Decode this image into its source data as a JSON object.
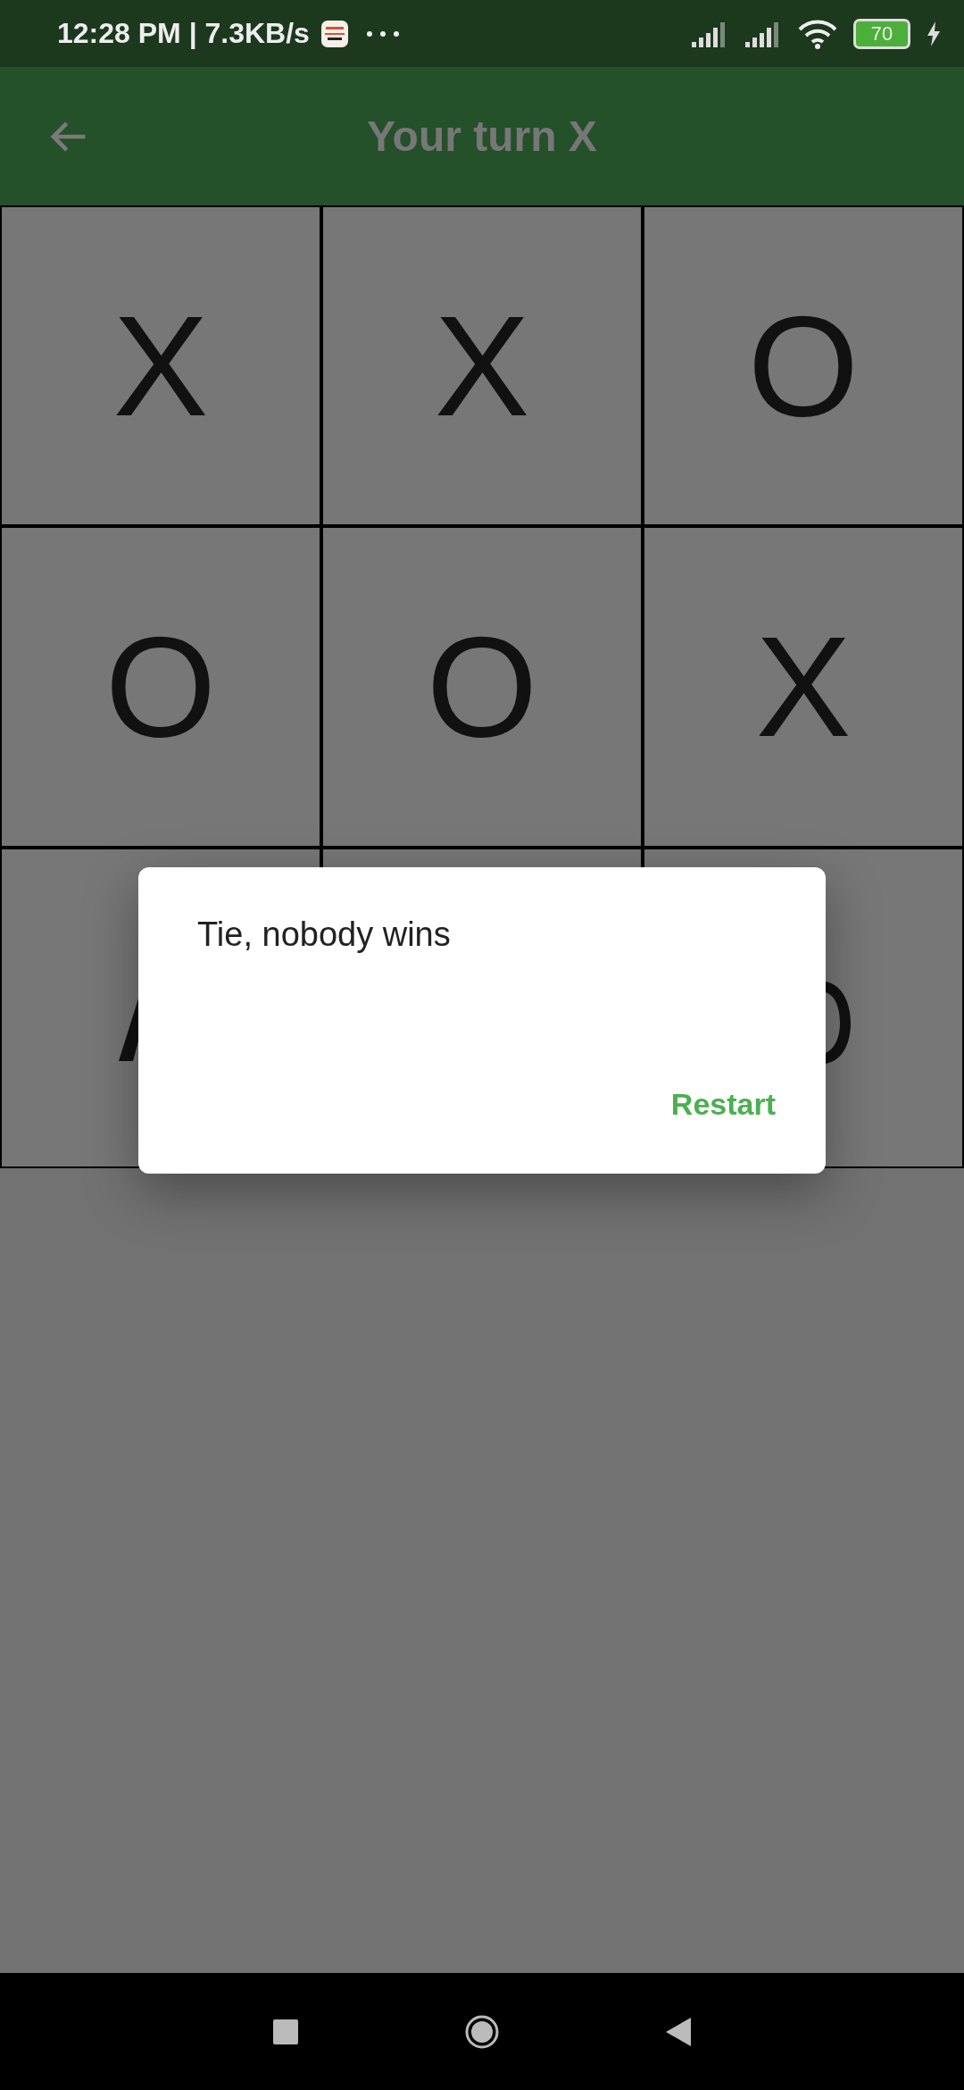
{
  "status_bar": {
    "time": "12:28 PM | 7.3KB/s",
    "battery": "70",
    "charging": true
  },
  "app_bar": {
    "title": "Your turn X"
  },
  "board": {
    "rows": [
      {
        "cells": [
          {
            "mark": "X"
          },
          {
            "mark": "X"
          },
          {
            "mark": "O"
          }
        ]
      },
      {
        "cells": [
          {
            "mark": "O"
          },
          {
            "mark": "O"
          },
          {
            "mark": "X"
          }
        ]
      },
      {
        "cells": [
          {},
          {},
          {}
        ]
      }
    ]
  },
  "dialog": {
    "message": "Tie, nobody wins",
    "actions": [
      "Restart"
    ]
  }
}
